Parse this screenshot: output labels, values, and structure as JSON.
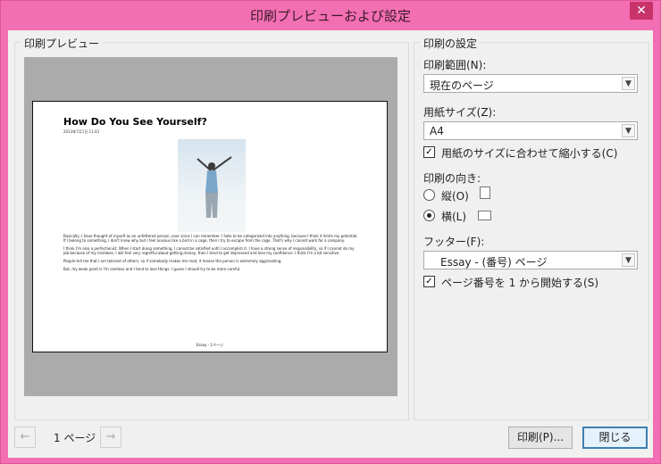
{
  "window": {
    "title": "印刷プレビューおよび設定",
    "close_glyph": "✕"
  },
  "preview": {
    "group_label": "印刷プレビュー",
    "document": {
      "title": "How Do You See Yourself?",
      "date": "2013年7月1日    11:43",
      "paragraphs": [
        "Basically, I have thought of myself as an unfettered person, ever since I can remember. I hate to be categorized into anything, because I think it limits my potential. If I belong to something, I don't know why but I feel anxious like a bird in a cage, then I try to escape from the cage. That's why I cannot work for a company.",
        "I think I'm also a perfectionist. When I start doing something, I cannot be satisfied until I accomplish it. I have a strong sense of responsibility, so if I cannot do my job because of my mistakes, I will feel very regretful about getting money, then I tend to get depressed and lose my confidence. I think I'm a bit sensitive.",
        "People tell me that I am tolerant of others, so if somebody makes me mad, it means the person is extremely aggravating.",
        "But, my weak point is I'm careless and I tend to lose things. I guess I should try to be more careful."
      ],
      "footer": "Essay - 1ページ"
    },
    "nav": {
      "prev_glyph": "←",
      "next_glyph": "→",
      "page_label": "1 ページ"
    }
  },
  "settings": {
    "group_label": "印刷の設定",
    "range_label": "印刷範囲(N):",
    "range_value": "現在のページ",
    "paper_label": "用紙サイズ(Z):",
    "paper_value": "A4",
    "fit_label": "用紙のサイズに合わせて縮小する(C)",
    "fit_checked": true,
    "orientation_label": "印刷の向き:",
    "portrait_label": "縦(O)",
    "landscape_label": "横(L)",
    "orientation_selected": "landscape",
    "footer_label": "フッター(F):",
    "footer_value": "Essay - (番号) ページ",
    "startone_label": "ページ番号を 1 から開始する(S)",
    "startone_checked": true,
    "dropdown_glyph": "▼",
    "check_glyph": "✓"
  },
  "buttons": {
    "print": "印刷(P)...",
    "close": "閉じる"
  }
}
